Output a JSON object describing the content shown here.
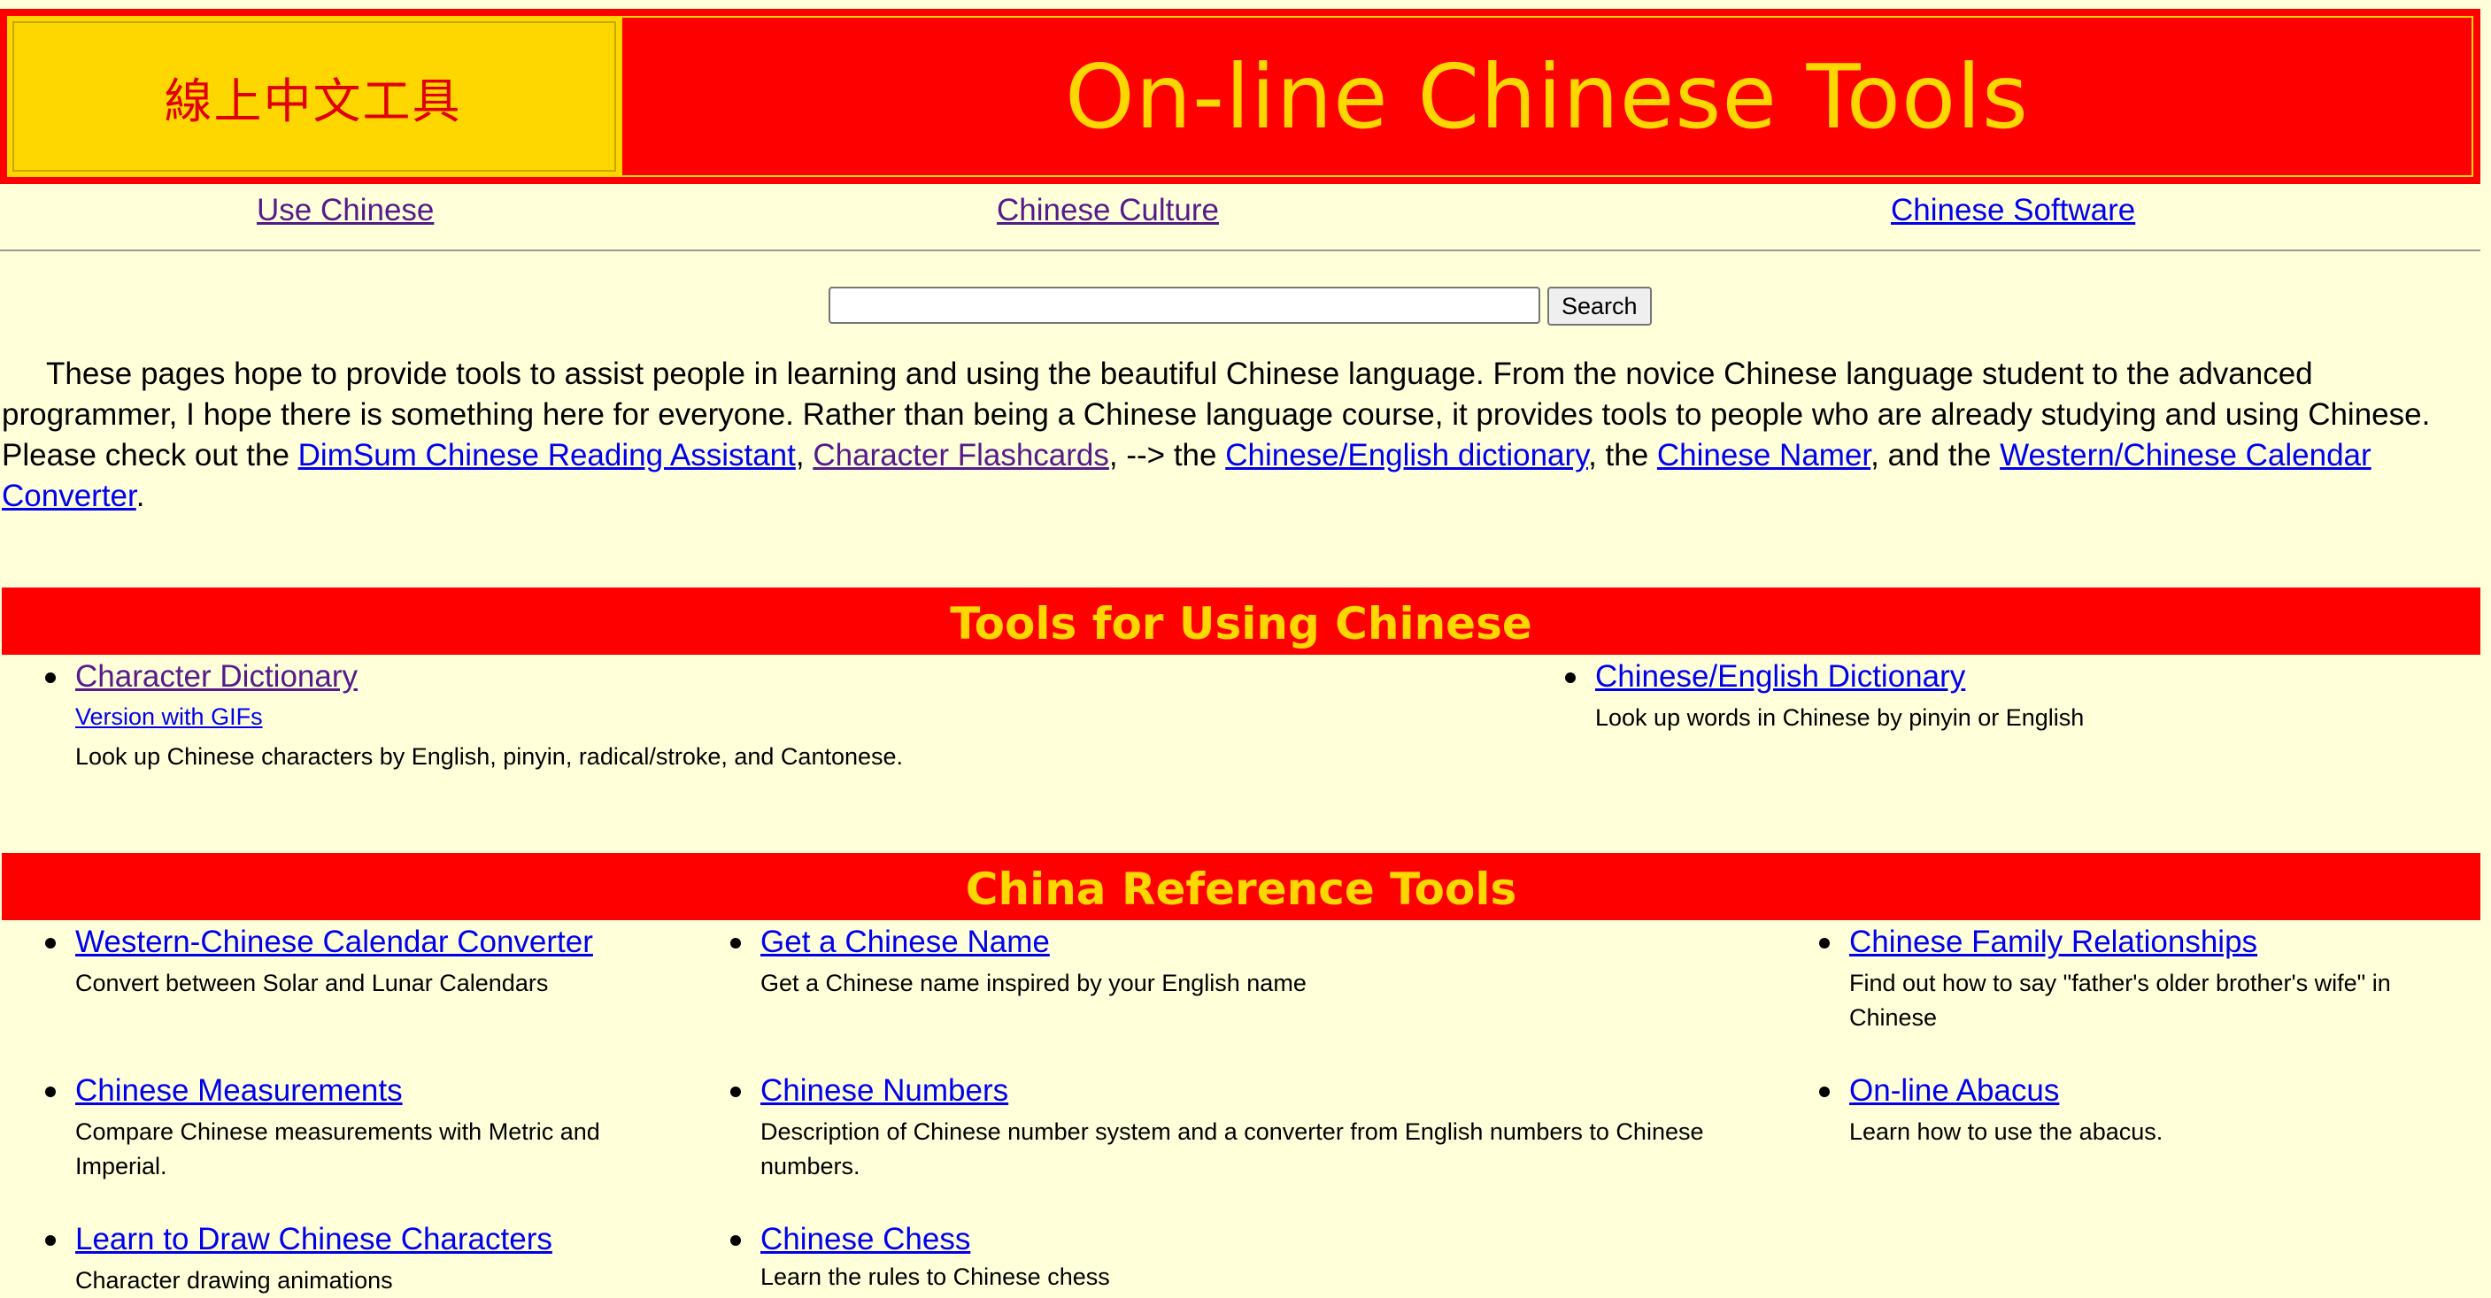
{
  "header": {
    "logo_text": "線上中文工具",
    "title": "On-line Chinese Tools"
  },
  "nav": {
    "use_chinese": "Use Chinese",
    "chinese_culture": "Chinese Culture",
    "chinese_software": "Chinese Software"
  },
  "search": {
    "value": "",
    "button_label": "Search"
  },
  "intro": {
    "text_1": "These pages hope to provide tools to assist people in learning and using the beautiful Chinese language. From the novice Chinese language student to the advanced programmer, I hope there is something here for everyone. Rather than being a Chinese language course, it provides tools to people who are already studying and using Chinese. Please check out the ",
    "link_dimsum": "DimSum Chinese Reading Assistant",
    "sep_1": ", ",
    "link_flashcards": "Character Flashcards",
    "sep_2": ", --> the ",
    "link_dictionary": "Chinese/English dictionary",
    "sep_3": ", the ",
    "link_namer": "Chinese Namer",
    "sep_4": ", and the ",
    "link_calendar": "Western/Chinese Calendar Converter",
    "end": "."
  },
  "sections": {
    "using": {
      "heading": "Tools for Using Chinese",
      "items": [
        {
          "title": "Character Dictionary",
          "sub": "Version with GIFs",
          "desc": "Look up Chinese characters by English, pinyin, radical/stroke, and Cantonese."
        },
        {
          "title": "Chinese/English Dictionary",
          "desc": "Look up words in Chinese by pinyin or English"
        }
      ]
    },
    "reference": {
      "heading": "China Reference Tools",
      "items": [
        {
          "title": "Western-Chinese Calendar Converter",
          "desc": "Convert between Solar and Lunar Calendars"
        },
        {
          "title": "Get a Chinese Name",
          "desc": "Get a Chinese name inspired by your English name"
        },
        {
          "title": "Chinese Family Relationships",
          "desc": "Find out how to say \"father's older brother's wife\" in Chinese"
        },
        {
          "title": "Chinese Measurements",
          "desc": "Compare Chinese measurements with Metric and Imperial."
        },
        {
          "title": "Chinese Numbers",
          "desc": "Description of Chinese number system and a converter from English numbers to Chinese numbers."
        },
        {
          "title": "On-line Abacus",
          "desc": "Learn how to use the abacus."
        },
        {
          "title": "Learn to Draw Chinese Characters",
          "desc": "Character drawing animations"
        },
        {
          "title": "Chinese Chess",
          "desc": "Learn the rules to Chinese chess"
        }
      ]
    }
  },
  "colors": {
    "background": "#ffffd9",
    "header_red": "#ff0000",
    "header_gold": "#ffd700",
    "link": "#0000ee",
    "visited_link": "#551a8b"
  }
}
